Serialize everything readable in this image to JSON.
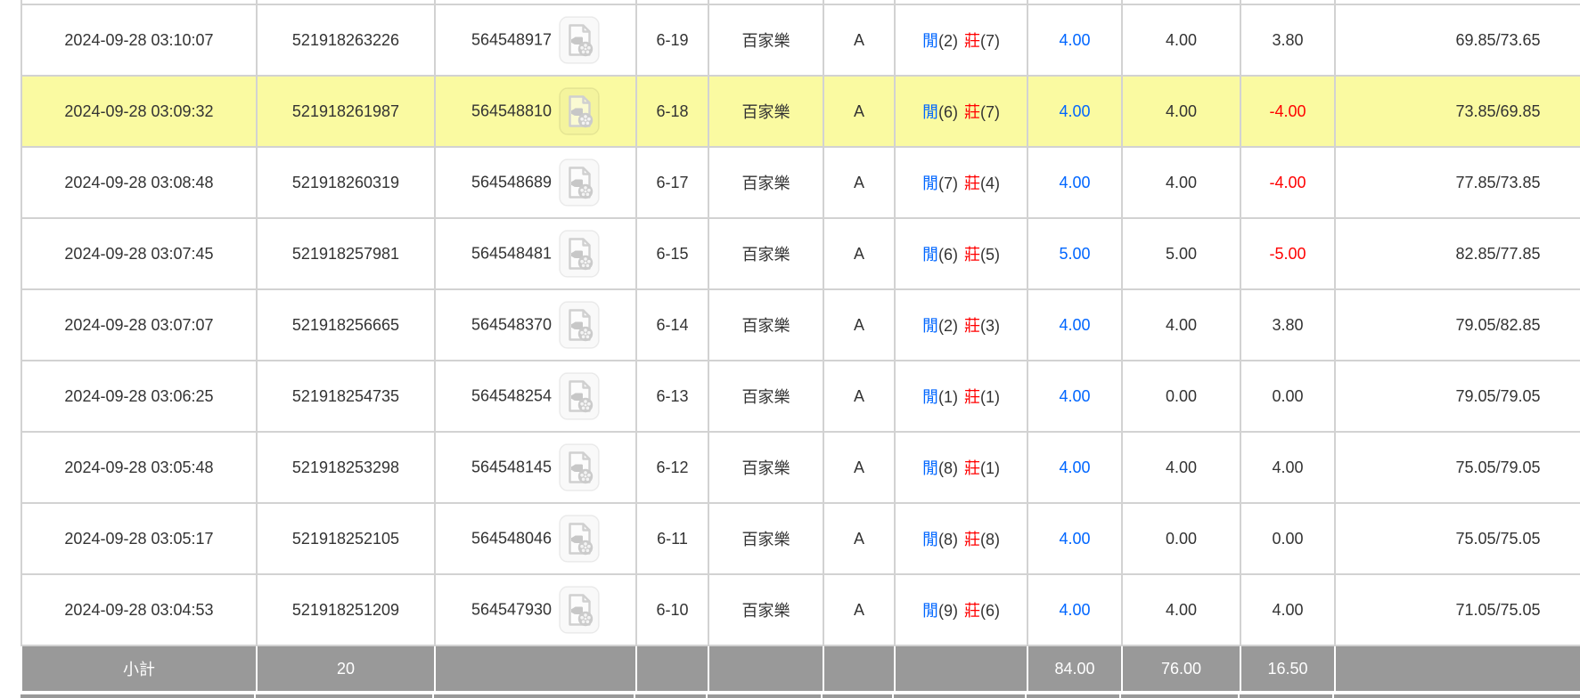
{
  "colors": {
    "accent_blue": "#0066ff",
    "accent_red": "#ff0000",
    "row_highlight": "#fafaa1",
    "footer_bg": "#999999",
    "grid_border": "#d2d2d2",
    "text": "#333333"
  },
  "icons": {
    "video_icon": "video-replay-file-icon"
  },
  "table": {
    "player_label": "閒",
    "banker_label": "莊",
    "rows": [
      {
        "time": "2024-09-28 03:10:07",
        "bet_id": "521918263226",
        "game_id": "564548917",
        "round": "6-19",
        "game_type": "百家樂",
        "table_code": "A",
        "player_score": "2",
        "banker_score": "7",
        "bet": "4.00",
        "valid": "4.00",
        "win_loss": "3.80",
        "balance": "69.85/73.65",
        "highlighted": false
      },
      {
        "time": "2024-09-28 03:09:32",
        "bet_id": "521918261987",
        "game_id": "564548810",
        "round": "6-18",
        "game_type": "百家樂",
        "table_code": "A",
        "player_score": "6",
        "banker_score": "7",
        "bet": "4.00",
        "valid": "4.00",
        "win_loss": "-4.00",
        "balance": "73.85/69.85",
        "highlighted": true
      },
      {
        "time": "2024-09-28 03:08:48",
        "bet_id": "521918260319",
        "game_id": "564548689",
        "round": "6-17",
        "game_type": "百家樂",
        "table_code": "A",
        "player_score": "7",
        "banker_score": "4",
        "bet": "4.00",
        "valid": "4.00",
        "win_loss": "-4.00",
        "balance": "77.85/73.85",
        "highlighted": false
      },
      {
        "time": "2024-09-28 03:07:45",
        "bet_id": "521918257981",
        "game_id": "564548481",
        "round": "6-15",
        "game_type": "百家樂",
        "table_code": "A",
        "player_score": "6",
        "banker_score": "5",
        "bet": "5.00",
        "valid": "5.00",
        "win_loss": "-5.00",
        "balance": "82.85/77.85",
        "highlighted": false
      },
      {
        "time": "2024-09-28 03:07:07",
        "bet_id": "521918256665",
        "game_id": "564548370",
        "round": "6-14",
        "game_type": "百家樂",
        "table_code": "A",
        "player_score": "2",
        "banker_score": "3",
        "bet": "4.00",
        "valid": "4.00",
        "win_loss": "3.80",
        "balance": "79.05/82.85",
        "highlighted": false
      },
      {
        "time": "2024-09-28 03:06:25",
        "bet_id": "521918254735",
        "game_id": "564548254",
        "round": "6-13",
        "game_type": "百家樂",
        "table_code": "A",
        "player_score": "1",
        "banker_score": "1",
        "bet": "4.00",
        "valid": "0.00",
        "win_loss": "0.00",
        "balance": "79.05/79.05",
        "highlighted": false
      },
      {
        "time": "2024-09-28 03:05:48",
        "bet_id": "521918253298",
        "game_id": "564548145",
        "round": "6-12",
        "game_type": "百家樂",
        "table_code": "A",
        "player_score": "8",
        "banker_score": "1",
        "bet": "4.00",
        "valid": "4.00",
        "win_loss": "4.00",
        "balance": "75.05/79.05",
        "highlighted": false
      },
      {
        "time": "2024-09-28 03:05:17",
        "bet_id": "521918252105",
        "game_id": "564548046",
        "round": "6-11",
        "game_type": "百家樂",
        "table_code": "A",
        "player_score": "8",
        "banker_score": "8",
        "bet": "4.00",
        "valid": "0.00",
        "win_loss": "0.00",
        "balance": "75.05/75.05",
        "highlighted": false
      },
      {
        "time": "2024-09-28 03:04:53",
        "bet_id": "521918251209",
        "game_id": "564547930",
        "round": "6-10",
        "game_type": "百家樂",
        "table_code": "A",
        "player_score": "9",
        "banker_score": "6",
        "bet": "4.00",
        "valid": "4.00",
        "win_loss": "4.00",
        "balance": "71.05/75.05",
        "highlighted": false
      }
    ],
    "footer": {
      "label": "小計",
      "count": "20",
      "bet_total": "84.00",
      "valid_total": "76.00",
      "winloss_total": "16.50"
    }
  }
}
